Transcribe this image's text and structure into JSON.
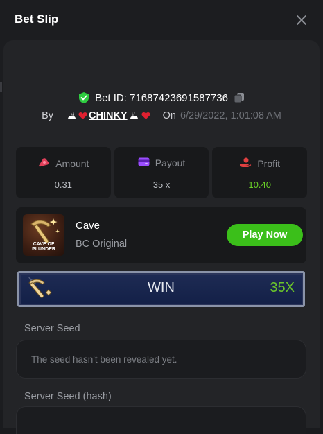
{
  "header": {
    "title": "Bet Slip"
  },
  "bet": {
    "bet_id_label": "Bet ID: 71687423691587736",
    "by_label": "By",
    "username": "CHINKY",
    "on_label": "On",
    "datetime": "6/29/2022, 1:01:08 AM"
  },
  "stats": {
    "amount": {
      "label": "Amount",
      "value": "0.31"
    },
    "payout": {
      "label": "Payout",
      "value": "35 x"
    },
    "profit": {
      "label": "Profit",
      "value": "10.40"
    }
  },
  "game": {
    "thumb_text": "Cave of Plunder",
    "name": "Cave",
    "subtitle": "BC Original",
    "play_label": "Play Now"
  },
  "result": {
    "label": "WIN",
    "multiplier": "35X"
  },
  "seeds": {
    "server_seed_label": "Server Seed",
    "server_seed_placeholder": "The seed hasn't been revealed yet.",
    "server_seed_hash_label": "Server Seed (hash)"
  },
  "colors": {
    "accent_green": "#3bbf1a",
    "profit_green": "#6ad027",
    "amount_icon": "#e0405a",
    "payout_icon": "#9b4dff",
    "profit_icon": "#e04040",
    "verified_icon": "#2ecc40",
    "background": "#1c1d20"
  },
  "icons": {
    "close": "close-icon",
    "verified": "shield-check-icon",
    "copy": "copy-icon",
    "amount": "coin-icon",
    "payout": "card-icon",
    "profit": "hand-coin-icon",
    "game": "pickaxe-icon"
  }
}
